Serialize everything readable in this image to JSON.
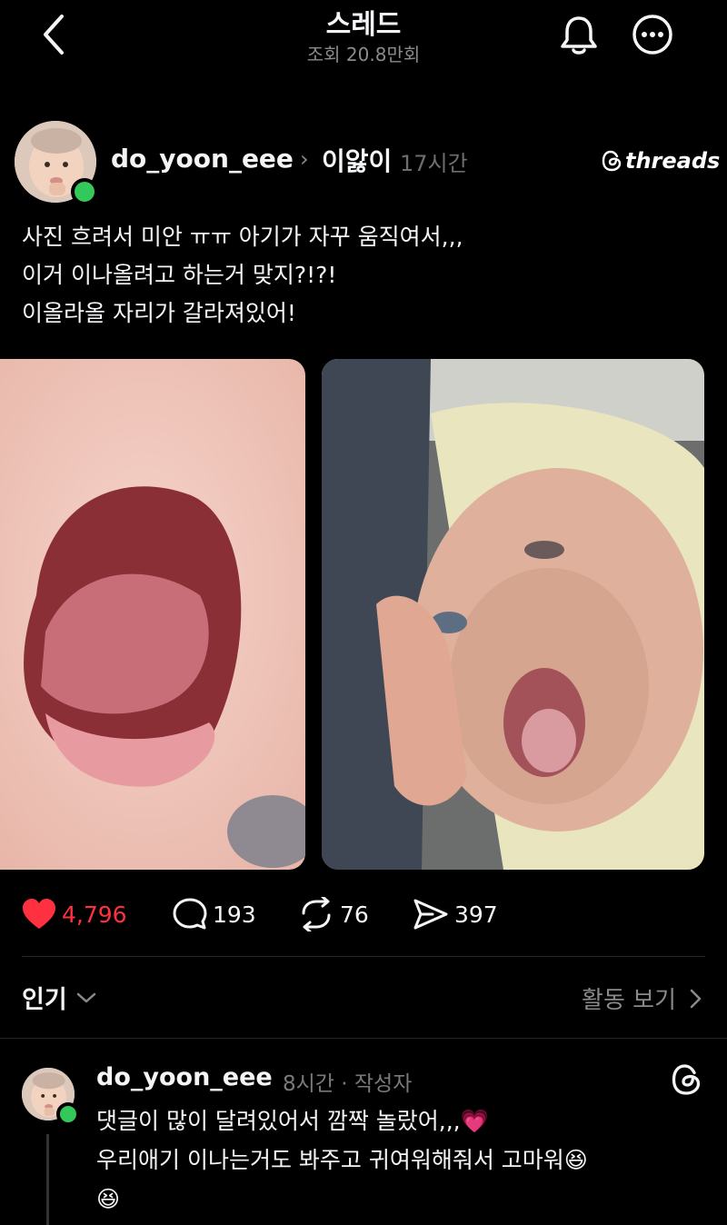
{
  "header": {
    "title": "스레드",
    "views": "조회 20.8만회"
  },
  "post": {
    "username": "do_yoon_eee",
    "topic": "이앓이",
    "time": "17시간",
    "brand": "threads",
    "text_lines": [
      "사진 흐려서 미안 ㅠㅠ 아기가 자꾸 움직여서,,,",
      "이거 이나올려고 하는거 맞지?!?!",
      "이올라올 자리가 갈라져있어!"
    ],
    "likes": "4,796",
    "comments": "193",
    "reposts": "76",
    "shares": "397"
  },
  "sort": {
    "label": "인기",
    "activity_label": "활동 보기"
  },
  "reply": {
    "username": "do_yoon_eee",
    "meta": "8시간 · 작성자",
    "line1": "댓글이 많이 달려있어서 깜짝 놀랐어,,,",
    "line1_emoji": "💗",
    "line2": "우리애기 이나는거도 봐주고 귀여워해줘서 고마워",
    "line2_emoji": "😆",
    "line3_emoji": "😆"
  },
  "colors": {
    "background": "#000000",
    "text": "#f3f5f7",
    "muted": "#8a8a8a",
    "like": "#ff3040",
    "online": "#34c759"
  },
  "icons": [
    "back-icon",
    "bell-icon",
    "more-icon",
    "heart-icon",
    "comment-icon",
    "repost-icon",
    "share-icon",
    "threads-icon",
    "chevron-down-icon",
    "chevron-right-icon"
  ]
}
